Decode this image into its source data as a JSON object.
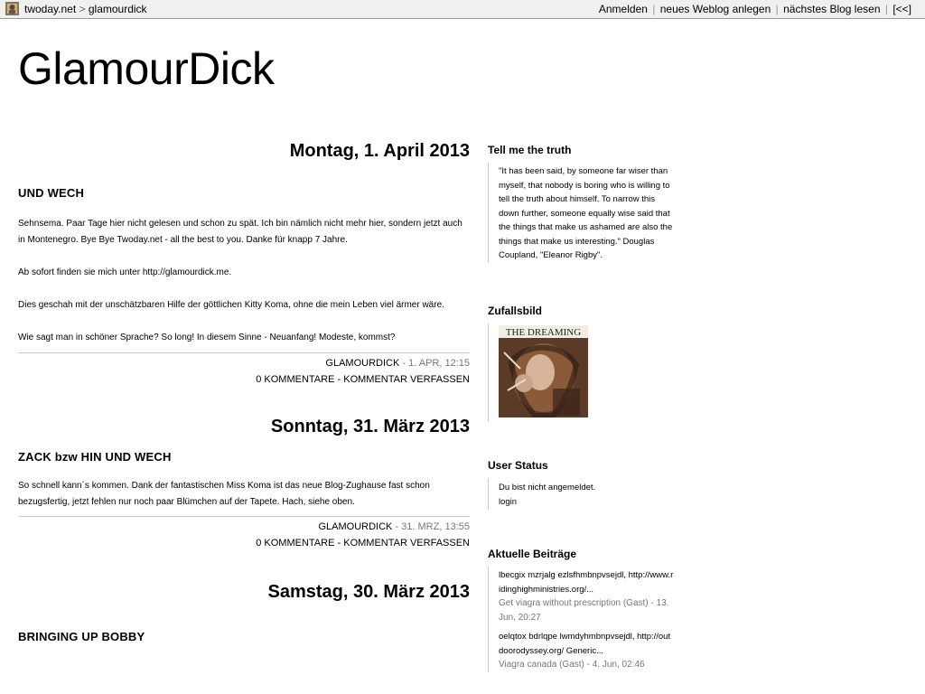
{
  "topbar": {
    "site": "twoday.net",
    "separator": ">",
    "blog": "glamourdick",
    "menu": {
      "login": "Anmelden",
      "new_weblog": "neues Weblog anlegen",
      "next_blog": "nächstes Blog lesen",
      "back": "[<<]",
      "pipe": "|"
    }
  },
  "site_title": "GlamourDick",
  "days": [
    {
      "date": "Montag, 1. April 2013",
      "story": {
        "title": "UND WECH",
        "paragraphs": [
          "Sehnsema. Paar Tage hier nicht gelesen und schon zu spät. Ich bin nämlich nicht mehr hier, sondern jetzt auch in Montenegro. Bye Bye Twoday.net - all the best to you. Danke für knapp 7 Jahre.",
          "Ab sofort finden sie mich unter http://glamourdick.me.",
          "Dies geschah mit der unschätzbaren Hilfe der göttlichen Kitty Koma, ohne die mein Leben viel ärmer wäre.",
          "Wie sagt man in schöner Sprache? So long! In diesem Sinne - Neuanfang! Modeste, kommst?"
        ],
        "author": "glamourdick",
        "time": "1. Apr, 12:15",
        "comments": "0 Kommentare",
        "write_comment": "Kommentar verfassen"
      }
    },
    {
      "date": "Sonntag, 31. März 2013",
      "story": {
        "title": "ZACK bzw HIN UND WECH",
        "paragraphs": [
          "So schnell kann´s kommen. Dank der fantastischen Miss Koma ist das neue Blog-Zughause fast schon bezugsfertig, jetzt fehlen nur noch paar Blümchen auf der Tapete. Hach, siehe oben."
        ],
        "author": "glamourdick",
        "time": "31. Mrz, 13:55",
        "comments": "0 Kommentare",
        "write_comment": "Kommentar verfassen"
      }
    },
    {
      "date": "Samstag, 30. März 2013",
      "story": {
        "title": "BRINGING UP BOBBY"
      }
    }
  ],
  "sidebar": {
    "truth": {
      "title": "Tell me the truth",
      "text": "\"It has been said, by someone far wiser than myself, that nobody is boring who is willing to tell the truth about himself. To narrow this down further, someone equally wise said that the things that make us ashamed are also the things that make us interesting.\" Douglas Coupland, \"Eleanor Rigby\"."
    },
    "random_image": {
      "title": "Zufallsbild",
      "caption": "THE DREAMING"
    },
    "user_status": {
      "title": "User Status",
      "line1": "Du bist nicht angemeldet.",
      "login": "login"
    },
    "recent": {
      "title": "Aktuelle Beiträge",
      "entries": [
        {
          "text": "lbecgix mzrjalg ezlsfhmbnpvsejdl, http://www.ridinghighministries.org/...",
          "meta": "Get viagra without prescription (Gast) - 13. Jun, 20:27"
        },
        {
          "text": "oelqtox bdrlqpe lwmdyhmbnpvsejdl, http://outdoorodyssey.org/ Generic...",
          "meta": "Viagra canada (Gast) - 4. Jun, 02:46"
        }
      ]
    }
  },
  "colors": {
    "topbar_bg": "#f0f0f0",
    "meta_gray": "#777777",
    "rule": "#cccccc"
  }
}
